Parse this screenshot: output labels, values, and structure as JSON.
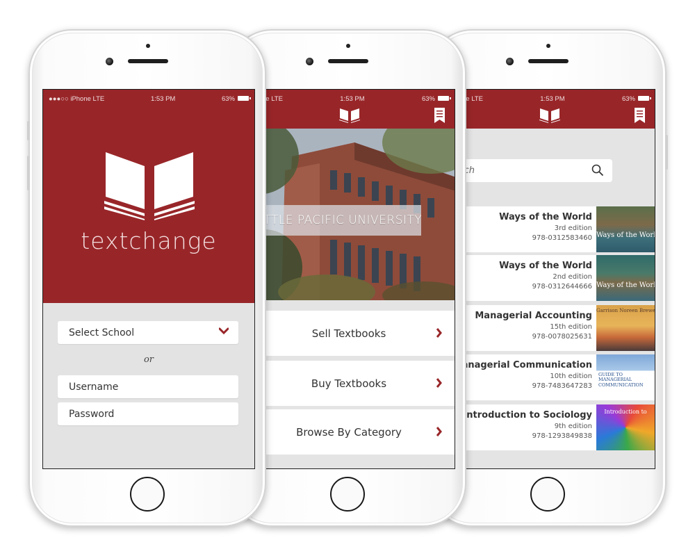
{
  "colors": {
    "brand_red": "#982629",
    "background": "#e4e4e4"
  },
  "status_bar": {
    "carrier": "●●●○○ iPhone LTE",
    "carrier_short": "iPhone LTE",
    "time": "1:53 PM",
    "battery": "63%"
  },
  "login": {
    "app_name": "textchange",
    "logo_icon": "open-book-icon",
    "school_select": "Select School",
    "or_label": "or",
    "username_placeholder": "Username",
    "password_placeholder": "Password"
  },
  "home": {
    "nav_icon": "open-book-icon",
    "bookmark_icon": "bookmark-list-icon",
    "campus_label": "SEATTLE PACIFIC UNIVERSITY",
    "menu": [
      {
        "label": "Sell Textbooks"
      },
      {
        "label": "Buy Textbooks"
      },
      {
        "label": "Browse By Category"
      }
    ]
  },
  "browse": {
    "search_placeholder": "Search",
    "search_icon": "search-icon",
    "books": [
      {
        "title": "Ways of the World",
        "edition": "3rd edition",
        "isbn": "978-0312583460",
        "cover_text": "Ways of the World"
      },
      {
        "title": "Ways of the World",
        "edition": "2nd edition",
        "isbn": "978-0312644666",
        "cover_text": "Ways of the World"
      },
      {
        "title": "Managerial Accounting",
        "edition": "15th edition",
        "isbn": "978-0078025631",
        "cover_text": "Garrison  Noreen  Brewer"
      },
      {
        "title": "Managerial Communication",
        "edition": "10th edition",
        "isbn": "978-7483647283",
        "cover_text": "GUIDE TO MANAGERIAL COMMUNICATION"
      },
      {
        "title": "Introduction to Sociology",
        "edition": "9th edition",
        "isbn": "978-1293849838",
        "cover_text": "Introduction to"
      }
    ]
  }
}
